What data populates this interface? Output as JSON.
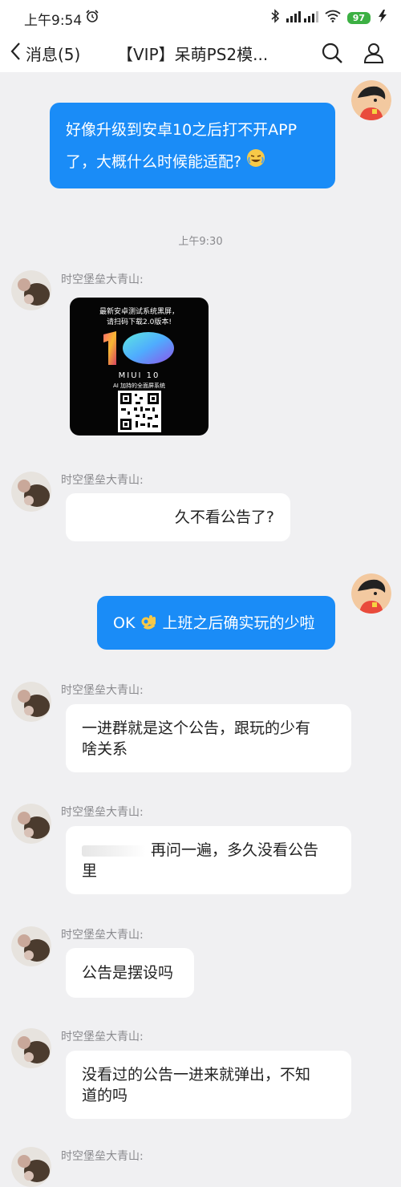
{
  "status_bar": {
    "time": "上午9:54",
    "battery": "97"
  },
  "header": {
    "back_label": "消息(5)",
    "title": "【VIP】呆萌PS2模..."
  },
  "messages": [
    {
      "direction": "out",
      "text_line1": "好像升级到安卓10之后打不开APP",
      "text_line2": "了，大概什么时候能适配?"
    },
    {
      "timestamp": "上午9:30"
    },
    {
      "direction": "in",
      "sender": "时空堡垒大青山:",
      "image": {
        "caption_line1": "最新安卓测试系统黑屏，",
        "caption_line2": "请扫码下载2.0版本!",
        "logo_text": "MIUI 10",
        "logo_subtext": "AI 加持的全面屏系统"
      }
    },
    {
      "direction": "in",
      "sender": "时空堡垒大青山:",
      "text": "久不看公告了?"
    },
    {
      "direction": "out",
      "text_a": "OK",
      "text_b": "上班之后确实玩的少啦"
    },
    {
      "direction": "in",
      "sender": "时空堡垒大青山:",
      "text_line1": "一进群就是这个公告，跟玩的少有",
      "text_line2": "啥关系"
    },
    {
      "direction": "in",
      "sender": "时空堡垒大青山:",
      "text_line1": "再问一遍，多久没看公告",
      "text_line2": "里"
    },
    {
      "direction": "in",
      "sender": "时空堡垒大青山:",
      "text": "公告是摆设吗"
    },
    {
      "direction": "in",
      "sender": "时空堡垒大青山:",
      "text_line1": "没看过的公告一进来就弹出，不知",
      "text_line2": "道的吗"
    },
    {
      "direction": "in",
      "sender": "时空堡垒大青山:"
    }
  ],
  "icons": {
    "back": "chevron-left-icon",
    "search": "search-icon",
    "profile": "person-icon",
    "alarm": "alarm-icon",
    "bluetooth": "bluetooth-icon",
    "signal": "signal-icon",
    "wifi": "wifi-icon",
    "battery": "battery-icon",
    "charging": "charging-icon"
  },
  "colors": {
    "outgoing_bubble": "#1a8cf7",
    "incoming_bubble": "#ffffff",
    "background": "#f0f0f2",
    "battery": "#3cb043"
  }
}
